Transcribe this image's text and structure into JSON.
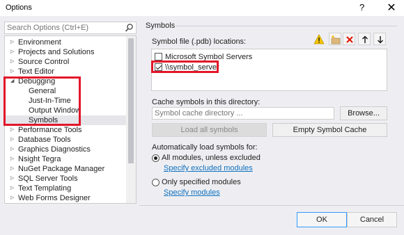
{
  "window": {
    "title": "Options",
    "help_glyph": "?",
    "close_glyph": "✕"
  },
  "search": {
    "placeholder": "Search Options (Ctrl+E)"
  },
  "tree": {
    "items": [
      {
        "label": "Environment",
        "expanded": false,
        "level": 0
      },
      {
        "label": "Projects and Solutions",
        "expanded": false,
        "level": 0
      },
      {
        "label": "Source Control",
        "expanded": false,
        "level": 0
      },
      {
        "label": "Text Editor",
        "expanded": false,
        "level": 0
      },
      {
        "label": "Debugging",
        "expanded": true,
        "level": 0
      },
      {
        "label": "General",
        "level": 1
      },
      {
        "label": "Just-In-Time",
        "level": 1
      },
      {
        "label": "Output Window",
        "level": 1
      },
      {
        "label": "Symbols",
        "level": 1,
        "selected": true
      },
      {
        "label": "Performance Tools",
        "expanded": false,
        "level": 0
      },
      {
        "label": "Database Tools",
        "expanded": false,
        "level": 0
      },
      {
        "label": "Graphics Diagnostics",
        "expanded": false,
        "level": 0
      },
      {
        "label": "Nsight Tegra",
        "expanded": false,
        "level": 0
      },
      {
        "label": "NuGet Package Manager",
        "expanded": false,
        "level": 0
      },
      {
        "label": "SQL Server Tools",
        "expanded": false,
        "level": 0
      },
      {
        "label": "Text Templating",
        "expanded": false,
        "level": 0
      },
      {
        "label": "Web Forms Designer",
        "expanded": false,
        "level": 0
      }
    ]
  },
  "panel": {
    "section_title": "Symbols",
    "locations_label": "Symbol file (.pdb) locations:",
    "toolbar": [
      "warning-icon",
      "add-folder-icon",
      "delete-icon",
      "move-up-icon",
      "move-down-icon"
    ],
    "locations": [
      {
        "label": "Microsoft Symbol Servers",
        "checked": false
      },
      {
        "label": "\\\\symbol_server",
        "checked": true
      }
    ],
    "cache_label": "Cache symbols in this directory:",
    "cache_placeholder": "Symbol cache directory ...",
    "browse_label": "Browse...",
    "load_all_label": "Load all symbols",
    "empty_cache_label": "Empty Symbol Cache",
    "auto_label": "Automatically load symbols for:",
    "option_all": "All modules, unless excluded",
    "link_excluded": "Specify excluded modules",
    "option_specified": "Only specified modules",
    "link_specified": "Specify modules",
    "selected_option": "all"
  },
  "footer": {
    "ok_label": "OK",
    "cancel_label": "Cancel"
  },
  "colors": {
    "highlight": "#e3162a",
    "link": "#0e70c0",
    "background": "#eeeef2",
    "warning": "#f5c400",
    "delete": "#e51400"
  }
}
